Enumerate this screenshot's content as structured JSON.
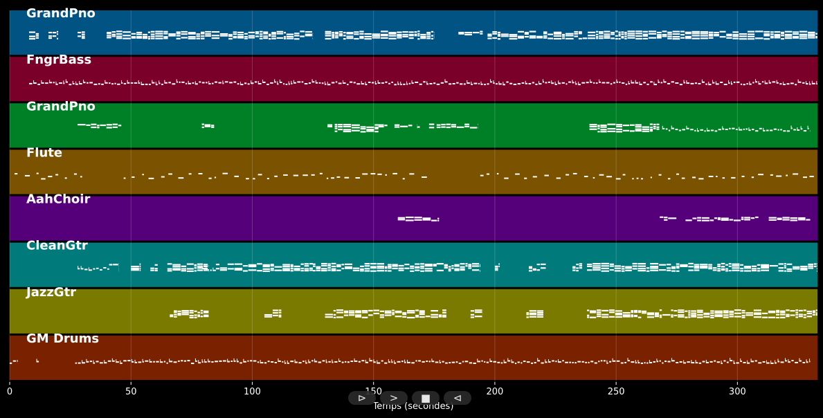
{
  "chart_data": {
    "type": "piano-roll",
    "title": "",
    "xlabel": "Temps (secondes)",
    "ylabel": "",
    "xlim": [
      0,
      333
    ],
    "x_ticks": [
      0,
      50,
      100,
      150,
      200,
      250,
      300
    ],
    "grid": true,
    "tracks": [
      {
        "name": "GrandPno",
        "color": "#005382",
        "segments": [
          [
            8,
            12,
            "dense"
          ],
          [
            16,
            20,
            "dense"
          ],
          [
            28,
            31,
            "dense"
          ],
          [
            40,
            125,
            "dense"
          ],
          [
            130,
            175,
            "dense"
          ],
          [
            185,
            195,
            "sparse"
          ],
          [
            197,
            333,
            "dense"
          ]
        ]
      },
      {
        "name": "FngrBass",
        "color": "#7a002a",
        "segments": [
          [
            8,
            333,
            "line"
          ]
        ]
      },
      {
        "name": "GrandPno",
        "color": "#008026",
        "segments": [
          [
            28,
            46,
            "sparse"
          ],
          [
            78,
            85,
            "sparse"
          ],
          [
            131,
            133,
            "sparse"
          ],
          [
            134,
            152,
            "dense"
          ],
          [
            152,
            168,
            "sparse"
          ],
          [
            168,
            175,
            "sparse"
          ],
          [
            176,
            193,
            "sparse"
          ],
          [
            239,
            268,
            "dense"
          ],
          [
            269,
            330,
            "line"
          ]
        ]
      },
      {
        "name": "Flute",
        "color": "#7a5200",
        "segments": [
          [
            2,
            30,
            "dots"
          ],
          [
            47,
            172,
            "dots"
          ],
          [
            194,
            330,
            "dots"
          ]
        ]
      },
      {
        "name": "AahChoir",
        "color": "#55007a",
        "segments": [
          [
            160,
            177,
            "sparse"
          ],
          [
            268,
            330,
            "sparse"
          ]
        ]
      },
      {
        "name": "CleanGtr",
        "color": "#007a7a",
        "segments": [
          [
            28,
            41,
            "line"
          ],
          [
            41,
            45,
            "dense"
          ],
          [
            50,
            54,
            "dense"
          ],
          [
            58,
            61,
            "dense"
          ],
          [
            65,
            82,
            "dense"
          ],
          [
            78,
            85,
            "line"
          ],
          [
            85,
            125,
            "dense"
          ],
          [
            125,
            176,
            "dense"
          ],
          [
            176,
            189,
            "dense"
          ],
          [
            189,
            194,
            "dense"
          ],
          [
            200,
            202,
            "dense"
          ],
          [
            214,
            221,
            "dense"
          ],
          [
            232,
            236,
            "dense"
          ],
          [
            238,
            333,
            "dense"
          ]
        ]
      },
      {
        "name": "JazzGtr",
        "color": "#7a7a00",
        "segments": [
          [
            66,
            82,
            "dense"
          ],
          [
            105,
            112,
            "dense"
          ],
          [
            130,
            180,
            "dense"
          ],
          [
            190,
            195,
            "dense"
          ],
          [
            213,
            220,
            "dense"
          ],
          [
            238,
            333,
            "dense"
          ]
        ]
      },
      {
        "name": "GM Drums",
        "color": "#7a2200",
        "segments": [
          [
            0,
            3,
            "line"
          ],
          [
            11,
            12,
            "line"
          ],
          [
            27,
            330,
            "line"
          ]
        ]
      }
    ]
  },
  "controls": [
    {
      "label": "⊳",
      "name": "play-forward-button"
    },
    {
      "label": ">",
      "name": "next-button"
    },
    {
      "label": "■",
      "name": "stop-button"
    },
    {
      "label": "⊲",
      "name": "play-back-button"
    }
  ]
}
